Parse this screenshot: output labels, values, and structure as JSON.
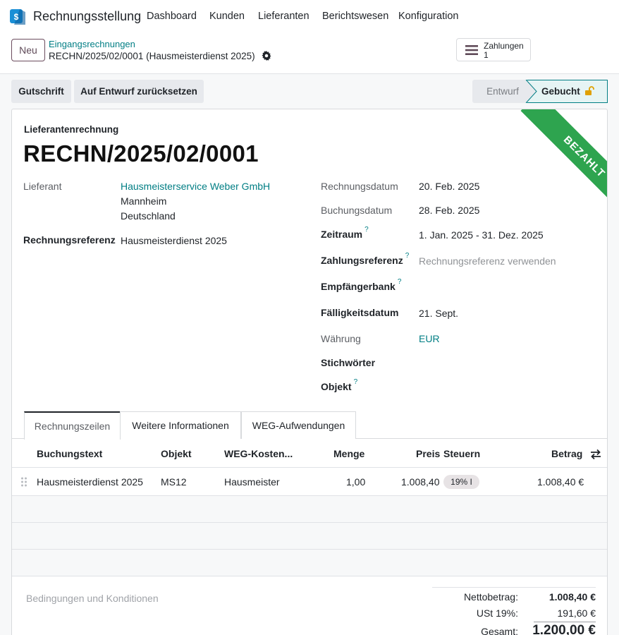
{
  "navbar": {
    "app_name": "Rechnungsstellung",
    "menu": [
      "Dashboard",
      "Kunden",
      "Lieferanten",
      "Berichtswesen",
      "Konfiguration"
    ]
  },
  "breadcrumb": {
    "new_label": "Neu",
    "parent": "Eingangsrechnungen",
    "current": "RECHN/2025/02/0001 (Hausmeisterdienst 2025)"
  },
  "smart_button": {
    "label": "Zahlungen",
    "count": "1"
  },
  "actions": {
    "credit_note": "Gutschrift",
    "reset_draft": "Auf Entwurf zurücksetzen"
  },
  "statusbar": {
    "draft": "Entwurf",
    "posted": "Gebucht"
  },
  "ribbon": "BEZAHLT",
  "form": {
    "doc_type": "Lieferantenrechnung",
    "doc_name": "RECHN/2025/02/0001",
    "left": {
      "vendor_label": "Lieferant",
      "vendor_name": "Hausmeisterservice Weber GmbH",
      "vendor_city": "Mannheim",
      "vendor_country": "Deutschland",
      "ref_label": "Rechnungsreferenz",
      "ref_value": "Hausmeisterdienst 2025"
    },
    "right": {
      "invoice_date_label": "Rechnungsdatum",
      "invoice_date": "20. Feb. 2025",
      "accounting_date_label": "Buchungsdatum",
      "accounting_date": "28. Feb. 2025",
      "period_label": "Zeitraum",
      "period": "1. Jan. 2025 - 31. Dez. 2025",
      "payment_ref_label": "Zahlungsreferenz",
      "payment_ref_placeholder": "Rechnungsreferenz verwenden",
      "bank_label": "Empfängerbank",
      "due_label": "Fälligkeitsdatum",
      "due_date": "21. Sept.",
      "currency_label": "Währung",
      "currency": "EUR",
      "tags_label": "Stichwörter",
      "object_label": "Objekt",
      "help_mark": "?"
    }
  },
  "tabs": [
    "Rechnungszeilen",
    "Weitere Informationen",
    "WEG-Aufwendungen"
  ],
  "table": {
    "headers": {
      "label": "Buchungstext",
      "object": "Objekt",
      "weg": "WEG-Kosten...",
      "qty": "Menge",
      "price": "Preis",
      "taxes": "Steuern",
      "amount": "Betrag"
    },
    "rows": [
      {
        "label": "Hausmeisterdienst 2025",
        "object": "MS12",
        "weg": "Hausmeister",
        "qty": "1,00",
        "price": "1.008,40",
        "tax": "19% I",
        "amount": "1.008,40 €"
      }
    ]
  },
  "terms_placeholder": "Bedingungen und Konditionen",
  "totals": {
    "net_label": "Nettobetrag:",
    "net": "1.008,40 €",
    "tax_label": "USt 19%:",
    "tax": "191,60 €",
    "total_label": "Gesamt:",
    "total": "1.200,00 €"
  },
  "colors": {
    "accent": "#017e84",
    "ribbon": "#2ea44f",
    "brand": "#714b67"
  }
}
